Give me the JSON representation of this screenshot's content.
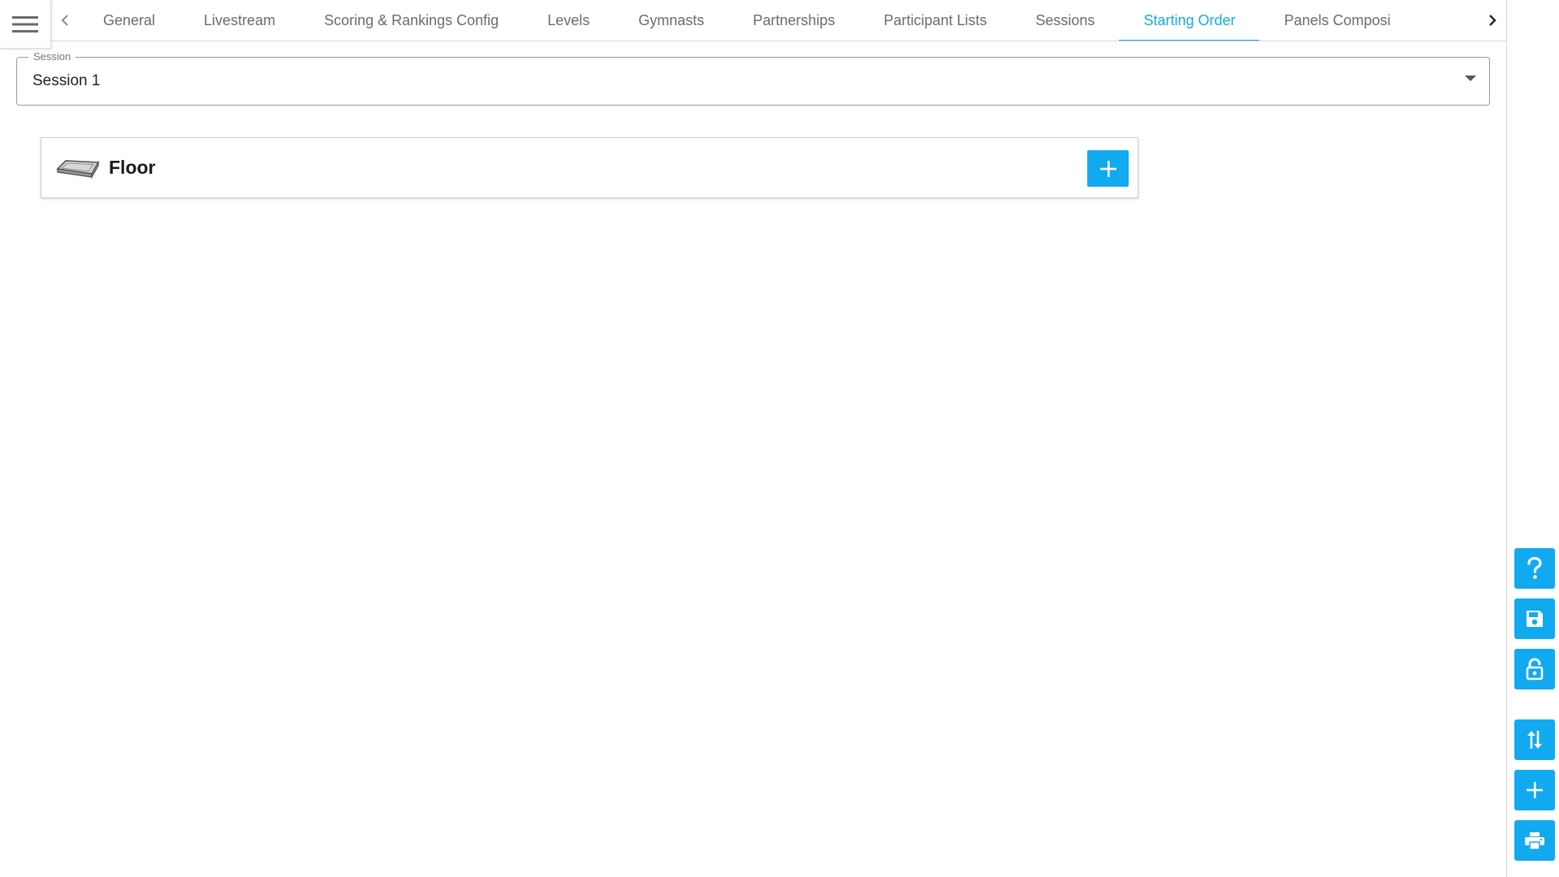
{
  "nav": {
    "menu_icon": "hamburger-icon",
    "prev_icon": "chevron-left-icon",
    "next_icon": "chevron-right-icon",
    "tabs": [
      {
        "label": "General",
        "active": false
      },
      {
        "label": "Livestream",
        "active": false
      },
      {
        "label": "Scoring & Rankings Config",
        "active": false
      },
      {
        "label": "Levels",
        "active": false
      },
      {
        "label": "Gymnasts",
        "active": false
      },
      {
        "label": "Partnerships",
        "active": false
      },
      {
        "label": "Participant Lists",
        "active": false
      },
      {
        "label": "Sessions",
        "active": false
      },
      {
        "label": "Starting Order",
        "active": true
      },
      {
        "label": "Panels Composi",
        "active": false
      }
    ]
  },
  "session_select": {
    "label": "Session",
    "value": "Session 1"
  },
  "apparatus": {
    "title": "Floor",
    "icon": "floor-mat-icon",
    "add_icon": "plus-icon"
  },
  "actions": [
    {
      "name": "help",
      "icon": "question-icon"
    },
    {
      "name": "save",
      "icon": "floppy-disk-icon"
    },
    {
      "name": "lock",
      "icon": "unlock-icon"
    },
    {
      "name": "sort",
      "icon": "swap-vertical-icon"
    },
    {
      "name": "add",
      "icon": "plus-icon"
    },
    {
      "name": "print",
      "icon": "printer-icon"
    }
  ],
  "colors": {
    "accent": "#11aaf0",
    "active_tab": "#16a9e6",
    "tab_text": "#6b6b6b"
  }
}
